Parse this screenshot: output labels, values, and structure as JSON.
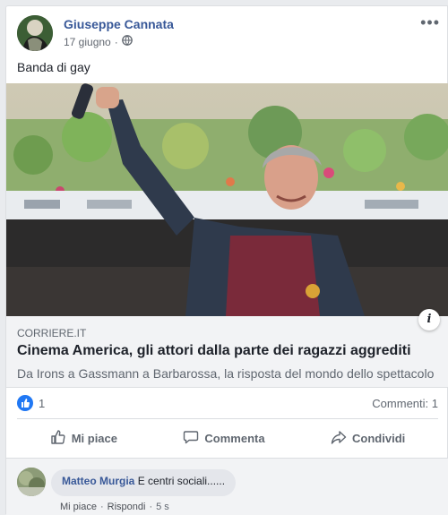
{
  "post": {
    "author": "Giuseppe Cannata",
    "date": "17 giugno",
    "separator": "·",
    "privacy_icon": "globe-icon",
    "more_icon": "more-options-icon",
    "more_label": "•••",
    "status": "Banda di gay"
  },
  "link": {
    "domain": "CORRIERE.IT",
    "title": "Cinema America, gli attori dalla parte dei ragazzi aggrediti",
    "description": "Da Irons a Gassmann a Barbarossa, la risposta del mondo dello spettacolo",
    "info_label": "i"
  },
  "stats": {
    "likes": "1",
    "comments": "Commenti: 1"
  },
  "actions": {
    "like": "Mi piace",
    "comment": "Commenta",
    "share": "Condividi"
  },
  "comment": {
    "author": "Matteo Murgia",
    "text": "E centri sociali......",
    "like": "Mi piace",
    "separator": "·",
    "reply": "Rispondi",
    "time": "5 s"
  },
  "colors": {
    "link_blue": "#385898",
    "like_blue": "#2078f4",
    "background": "#e9ebee"
  }
}
